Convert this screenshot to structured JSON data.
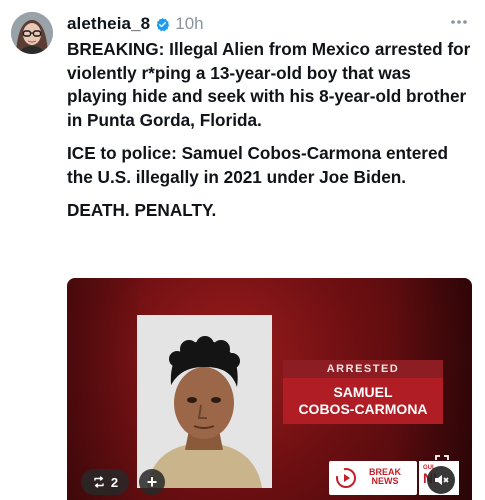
{
  "post": {
    "username": "aletheia_8",
    "time": "10h",
    "paragraphs": [
      "BREAKING: Illegal Alien from Mexico arrested for violently r*ping a 13-year-old boy that was playing hide and seek with his 8-year-old brother in Punta Gorda, Florida.",
      "ICE to police: Samuel Cobos-Carmona entered the U.S. illegally in 2021 under Joe Biden.",
      "DEATH. PENALTY."
    ]
  },
  "media": {
    "banner_label": "ARRESTED",
    "banner_name_line1": "SAMUEL",
    "banner_name_line2": "COBOS-CARMONA",
    "breaking_news_line1": "BREAK",
    "breaking_news_line2": "NEWS",
    "channel_partial": "NI",
    "gulf_partial": "GUL",
    "repost_count": "2",
    "add_symbol": "+"
  },
  "icons": {
    "verified": "verified-badge-icon",
    "more": "more-dots-icon",
    "repost": "repost-icon",
    "mute": "muted-speaker-icon",
    "expand": "expand-icon"
  },
  "colors": {
    "verified_blue": "#1d9bf0",
    "banner_red": "#b11d24",
    "banner_dark": "#8c1d22"
  }
}
